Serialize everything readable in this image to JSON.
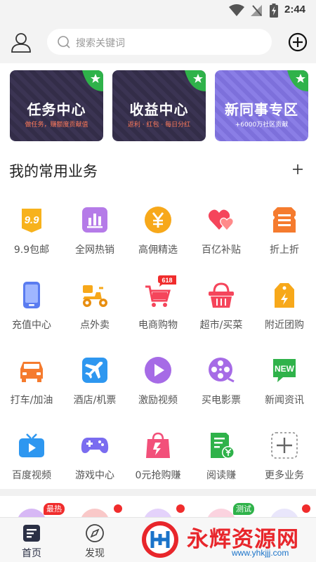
{
  "status": {
    "time": "2:44"
  },
  "search": {
    "placeholder": "搜索关键词"
  },
  "banners": [
    {
      "title": "任务中心",
      "subtitle": "做任务，赚额度贡献值"
    },
    {
      "title": "收益中心",
      "subtitle": "返利 · 红包 · 每日分红"
    },
    {
      "title": "新同事专区",
      "subtitle": "+6000万社区贡献"
    }
  ],
  "section": {
    "title": "我的常用业务"
  },
  "services": [
    {
      "label": "9.9包邮",
      "icon": "nine-nine-icon"
    },
    {
      "label": "全网热销",
      "icon": "bar-chart-icon"
    },
    {
      "label": "高佣精选",
      "icon": "yen-coin-icon"
    },
    {
      "label": "百亿补贴",
      "icon": "hearts-icon"
    },
    {
      "label": "折上折",
      "icon": "ticket-icon"
    },
    {
      "label": "充值中心",
      "icon": "phone-icon"
    },
    {
      "label": "点外卖",
      "icon": "scooter-icon"
    },
    {
      "label": "电商购物",
      "icon": "shopping-cart-icon",
      "badge": "618"
    },
    {
      "label": "超市/买菜",
      "icon": "basket-icon"
    },
    {
      "label": "附近团购",
      "icon": "price-tag-icon"
    },
    {
      "label": "打车/加油",
      "icon": "car-icon"
    },
    {
      "label": "酒店/机票",
      "icon": "airplane-icon"
    },
    {
      "label": "激励视频",
      "icon": "play-icon"
    },
    {
      "label": "买电影票",
      "icon": "film-reel-icon"
    },
    {
      "label": "新闻资讯",
      "icon": "new-badge-icon",
      "icon_text": "NEW"
    },
    {
      "label": "百度视频",
      "icon": "tv-icon"
    },
    {
      "label": "游戏中心",
      "icon": "gamepad-icon"
    },
    {
      "label": "0元抢购赚",
      "icon": "shopping-bag-icon"
    },
    {
      "label": "阅读赚",
      "icon": "document-coin-icon"
    },
    {
      "label": "更多业务",
      "icon": "more-plus-icon"
    }
  ],
  "peek": {
    "tag_hot": "最热",
    "tag_test": "测试"
  },
  "tabs": [
    {
      "label": "首页",
      "icon": "home-icon"
    },
    {
      "label": "发现",
      "icon": "compass-icon"
    }
  ],
  "watermark": {
    "text": "永辉资源网",
    "url": "www.yhkjjj.com"
  },
  "colors": {
    "accent_red": "#e8262b",
    "star_green": "#2fb24a",
    "badge_red": "#f02c2c"
  }
}
